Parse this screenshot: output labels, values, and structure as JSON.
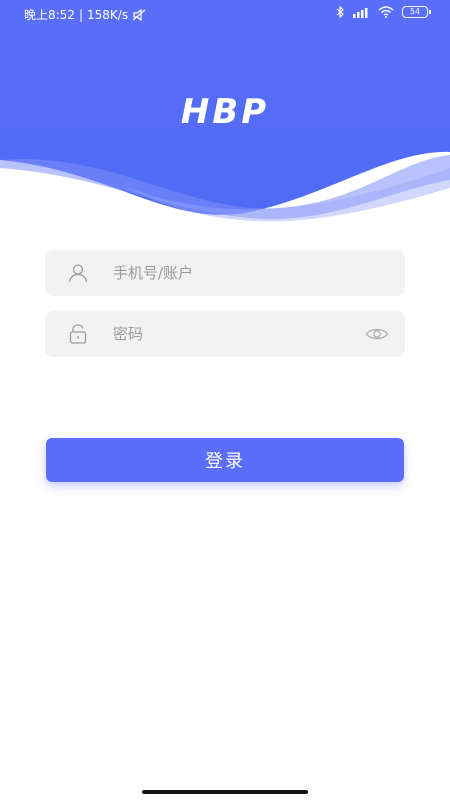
{
  "status_bar": {
    "time": "晚上8:52",
    "separator": "|",
    "network_speed": "158K/s",
    "battery_level": "54",
    "icons": [
      "mute-icon",
      "bluetooth-icon",
      "signal-icon",
      "wifi-icon",
      "battery-icon"
    ]
  },
  "header": {
    "logo_text": "HBP",
    "gradient_colors": [
      "#4a6cf7",
      "#5b6cf9"
    ]
  },
  "form": {
    "username": {
      "placeholder": "手机号/账户",
      "value": "",
      "icon": "user-icon"
    },
    "password": {
      "placeholder": "密码",
      "value": "",
      "icon": "lock-icon",
      "toggle_icon": "eye-icon"
    },
    "login_label": "登录"
  },
  "colors": {
    "accent": "#5a6ef9",
    "field_background": "#f2f2f2",
    "placeholder": "#9a9a9a"
  }
}
